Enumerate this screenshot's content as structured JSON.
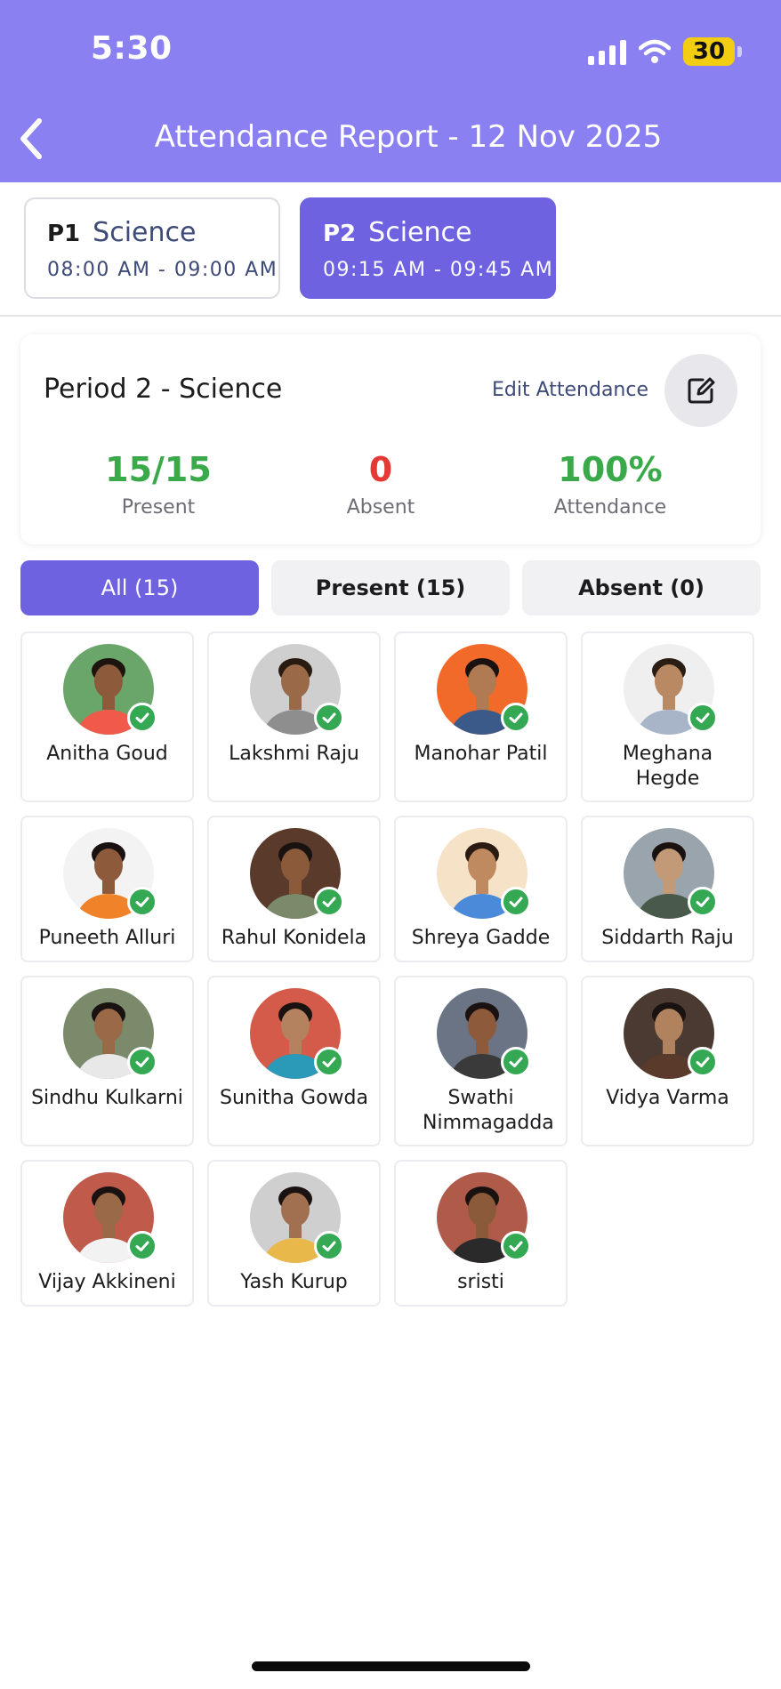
{
  "status_bar": {
    "time": "5:30",
    "battery": "30"
  },
  "header": {
    "title": "Attendance Report - 12 Nov 2025"
  },
  "periods": [
    {
      "code": "P1",
      "subject": "Science",
      "time": "08:00 AM - 09:00 AM",
      "active": false
    },
    {
      "code": "P2",
      "subject": "Science",
      "time": "09:15 AM - 09:45 AM",
      "active": true
    }
  ],
  "summary": {
    "period_label": "Period 2 - Science",
    "edit_label": "Edit Attendance",
    "present_value": "15/15",
    "present_label": "Present",
    "absent_value": "0",
    "absent_label": "Absent",
    "attendance_value": "100%",
    "attendance_label": "Attendance"
  },
  "filters": {
    "all": "All (15)",
    "present": "Present (15)",
    "absent": "Absent (0)"
  },
  "colors": {
    "header": "#8a80f2",
    "accent": "#6e62e0",
    "present": "#3aa94a",
    "absent": "#e53935",
    "check": "#34a853"
  },
  "students": [
    {
      "name": "Anitha Goud",
      "bg": "#6aa56a",
      "skin": "#8d5a3b",
      "hair": "#1e140e",
      "shirt": "#f05a4a"
    },
    {
      "name": "Lakshmi Raju",
      "bg": "#cfcfcf",
      "skin": "#9a6a48",
      "hair": "#2a1b12",
      "shirt": "#8e8e8e"
    },
    {
      "name": "Manohar Patil",
      "bg": "#f26a2a",
      "skin": "#b07a52",
      "hair": "#1a1210",
      "shirt": "#3b5a8a"
    },
    {
      "name": "Meghana Hegde",
      "bg": "#efefef",
      "skin": "#b88962",
      "hair": "#2a1d14",
      "shirt": "#a8b4c8"
    },
    {
      "name": "Puneeth Alluri",
      "bg": "#f3f3f3",
      "skin": "#8d5a3b",
      "hair": "#1a1210",
      "shirt": "#f0822a"
    },
    {
      "name": "Rahul Konidela",
      "bg": "#5a3a2a",
      "skin": "#8a5a3a",
      "hair": "#1a1210",
      "shirt": "#7a8a6a"
    },
    {
      "name": "Shreya Gadde",
      "bg": "#f6e2c6",
      "skin": "#c08a60",
      "hair": "#2a1b12",
      "shirt": "#4a8ad8"
    },
    {
      "name": "Siddarth Raju",
      "bg": "#9aa4ac",
      "skin": "#c39a78",
      "hair": "#1a1210",
      "shirt": "#4a5a4a"
    },
    {
      "name": "Sindhu Kulkarni",
      "bg": "#7a8a6a",
      "skin": "#9a6a48",
      "hair": "#1a1210",
      "shirt": "#e8e8e8"
    },
    {
      "name": "Sunitha Gowda",
      "bg": "#d45a4a",
      "skin": "#b58260",
      "hair": "#1a1210",
      "shirt": "#2a9ab8"
    },
    {
      "name": "Swathi Nimmagadda",
      "bg": "#6a7484",
      "skin": "#8d5a3b",
      "hair": "#1a1210",
      "shirt": "#3a3a3a"
    },
    {
      "name": "Vidya Varma",
      "bg": "#4a3a32",
      "skin": "#b0825e",
      "hair": "#1a1210",
      "shirt": "#5a3a2a"
    },
    {
      "name": "Vijay Akkineni",
      "bg": "#c05a4a",
      "skin": "#9a6a48",
      "hair": "#1a1210",
      "shirt": "#f2f2f2"
    },
    {
      "name": "Yash Kurup",
      "bg": "#cfcfcf",
      "skin": "#a07050",
      "hair": "#1a1210",
      "shirt": "#e8b84a"
    },
    {
      "name": "sristi",
      "bg": "#b05a4a",
      "skin": "#8a5a3a",
      "hair": "#1a1210",
      "shirt": "#2a2a2a"
    }
  ]
}
